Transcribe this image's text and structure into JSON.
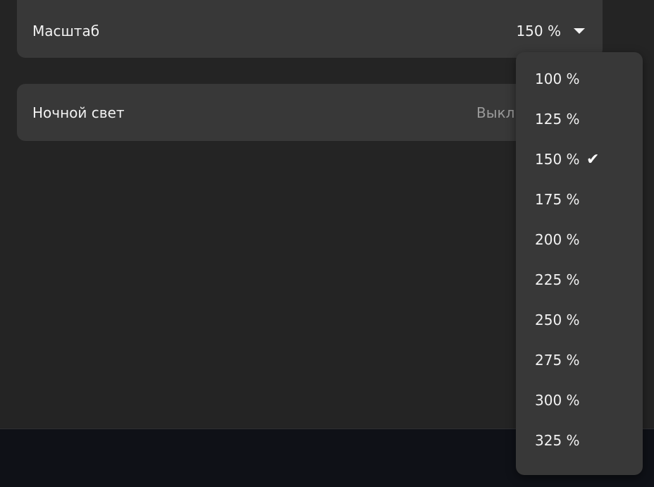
{
  "settings": {
    "scale": {
      "label": "Масштаб",
      "value": "150 %"
    },
    "night_light": {
      "label": "Ночной свет",
      "value": "Выкл"
    }
  },
  "scale_menu": {
    "options": [
      "100 %",
      "125 %",
      "150 %",
      "175 %",
      "200 %",
      "225 %",
      "250 %",
      "275 %",
      "300 %",
      "325 %"
    ],
    "selected": "150 %",
    "check_icon": "checkmark-icon"
  },
  "colors": {
    "background": "#242424",
    "card": "#383838",
    "bottom_bar": "#0f1117",
    "text": "#f2f2f2",
    "muted_text": "#9a9a9a"
  }
}
